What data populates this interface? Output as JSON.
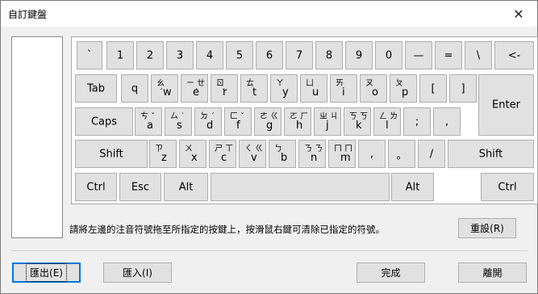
{
  "window": {
    "title": "自訂鍵盤",
    "close_glyph": "✕"
  },
  "hint_text": "請將左邊的注音符號拖至所指定的按鍵上，按滑鼠右鍵可清除已指定的符號。",
  "buttons": {
    "reset": "重設(R)",
    "export": "匯出(E)",
    "import": "匯入(I)",
    "done": "完成",
    "leave": "離開"
  },
  "keys": [
    {
      "id": "grave",
      "main": "`"
    },
    {
      "id": "1",
      "main": "1"
    },
    {
      "id": "2",
      "main": "2"
    },
    {
      "id": "3",
      "main": "3"
    },
    {
      "id": "4",
      "main": "4"
    },
    {
      "id": "5",
      "main": "5"
    },
    {
      "id": "6",
      "main": "6"
    },
    {
      "id": "7",
      "main": "7"
    },
    {
      "id": "8",
      "main": "8"
    },
    {
      "id": "9",
      "main": "9"
    },
    {
      "id": "0",
      "main": "0"
    },
    {
      "id": "minus",
      "main": "—"
    },
    {
      "id": "equal",
      "main": "="
    },
    {
      "id": "backslash",
      "main": "\\"
    },
    {
      "id": "backspace",
      "main": "<-"
    },
    {
      "id": "tab",
      "main": "Tab"
    },
    {
      "id": "q",
      "main": "q"
    },
    {
      "id": "w",
      "main": "w",
      "zy": "ㄠ\n ˊ"
    },
    {
      "id": "e",
      "main": "e",
      "zy": "ㄧ ㄝ\n   ˊ"
    },
    {
      "id": "r",
      "main": "r",
      "zy": "ㄖ\n  ˊ"
    },
    {
      "id": "t",
      "main": "t",
      "zy": "ㄊ"
    },
    {
      "id": "y",
      "main": "y",
      "zy": "ㄚ"
    },
    {
      "id": "u",
      "main": "u",
      "zy": "ㄩ"
    },
    {
      "id": "i",
      "main": "i",
      "zy": "ㄞ"
    },
    {
      "id": "o",
      "main": "o",
      "zy": "ㄡ"
    },
    {
      "id": "p",
      "main": "p",
      "zy": "ㄆ"
    },
    {
      "id": "lbracket",
      "main": "["
    },
    {
      "id": "rbracket",
      "main": "]"
    },
    {
      "id": "enter",
      "main": "Enter"
    },
    {
      "id": "caps",
      "main": "Caps"
    },
    {
      "id": "a",
      "main": "a",
      "zy": "ㄘ ˇ"
    },
    {
      "id": "s",
      "main": "s",
      "zy": "ㄙ ˙"
    },
    {
      "id": "d",
      "main": "d",
      "zy": "ㄉ ˊ"
    },
    {
      "id": "f",
      "main": "f",
      "zy": "ㄈ ˇ"
    },
    {
      "id": "g",
      "main": "g",
      "zy": "ㄜ ㄍ"
    },
    {
      "id": "h",
      "main": "h",
      "zy": "ㄛ ㄏ"
    },
    {
      "id": "j",
      "main": "j",
      "zy": "ㄓ ㄐ"
    },
    {
      "id": "k",
      "main": "k",
      "zy": "ㄎ ㄎ"
    },
    {
      "id": "l",
      "main": "l",
      "zy": "ㄥ ㄌ"
    },
    {
      "id": "semicolon",
      "main": ";"
    },
    {
      "id": "quote",
      "main": ","
    },
    {
      "id": "lshift",
      "main": "Shift"
    },
    {
      "id": "z",
      "main": "z",
      "zy": "ㄗ"
    },
    {
      "id": "x",
      "main": "x",
      "zy": "ㄨ"
    },
    {
      "id": "c",
      "main": "c",
      "zy": "ㄕ ㄒ"
    },
    {
      "id": "v",
      "main": "v",
      "zy": "ㄑ ㄍ"
    },
    {
      "id": "b",
      "main": "b",
      "zy": "ㄅ"
    },
    {
      "id": "n",
      "main": "n",
      "zy": "ㄋ ㄋ"
    },
    {
      "id": "m",
      "main": "m",
      "zy": "ㄇ ㄇ"
    },
    {
      "id": "comma",
      "main": ","
    },
    {
      "id": "period",
      "main": "。"
    },
    {
      "id": "slash",
      "main": "/"
    },
    {
      "id": "rshift",
      "main": "Shift"
    },
    {
      "id": "lctrl",
      "main": "Ctrl"
    },
    {
      "id": "esc",
      "main": "Esc"
    },
    {
      "id": "lalt",
      "main": "Alt"
    },
    {
      "id": "space",
      "main": ""
    },
    {
      "id": "ralt",
      "main": "Alt"
    },
    {
      "id": "rctrl",
      "main": "Ctrl"
    }
  ]
}
